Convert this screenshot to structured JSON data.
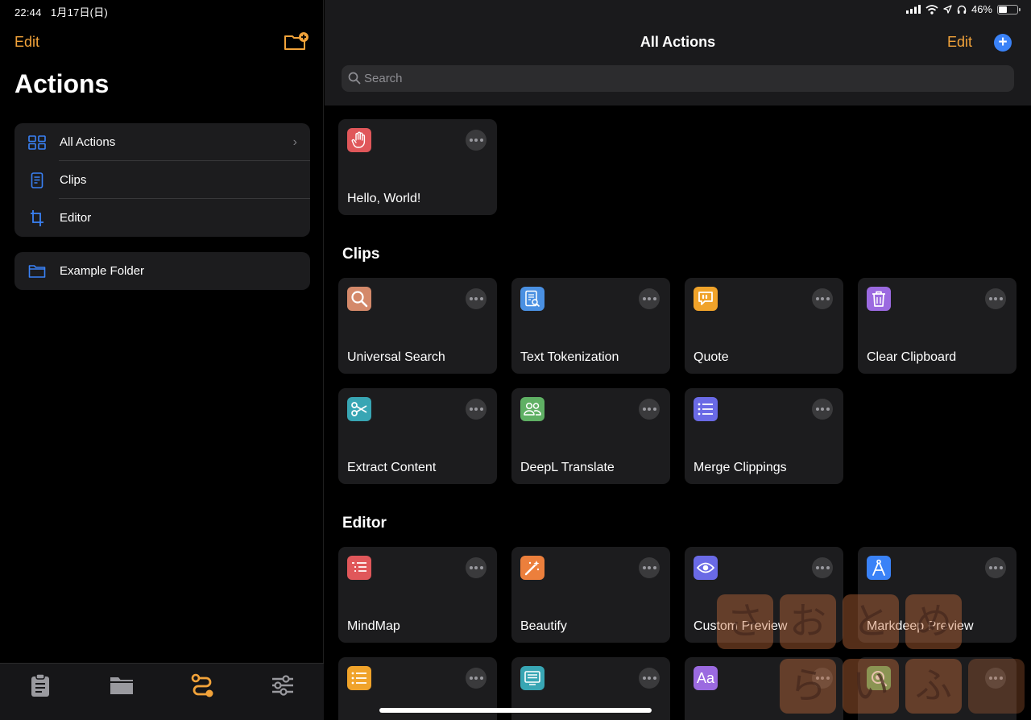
{
  "status_bar": {
    "time": "22:44",
    "date": "1月17日(日)",
    "battery": "46%",
    "battery_level": 0.46
  },
  "sidebar": {
    "edit_label": "Edit",
    "title": "Actions",
    "items": [
      {
        "label": "All Actions",
        "icon": "grid-icon"
      },
      {
        "label": "Clips",
        "icon": "document-icon"
      },
      {
        "label": "Editor",
        "icon": "crop-icon"
      }
    ],
    "folders": [
      {
        "label": "Example Folder",
        "icon": "folder-icon"
      }
    ]
  },
  "tabbar": {
    "tabs": [
      {
        "icon": "clipboard-icon",
        "active": false
      },
      {
        "icon": "folder-icon",
        "active": false
      },
      {
        "icon": "route-icon",
        "active": true
      },
      {
        "icon": "sliders-icon",
        "active": false
      }
    ]
  },
  "main": {
    "title": "All Actions",
    "edit_label": "Edit",
    "search_placeholder": "Search",
    "ungrouped": [
      {
        "name": "Hello, World!",
        "icon": "hand-icon",
        "color": "#e0575a"
      }
    ],
    "sections": [
      {
        "title": "Clips",
        "actions": [
          {
            "name": "Universal Search",
            "icon": "magnifier-icon",
            "color": "#d4896a"
          },
          {
            "name": "Text Tokenization",
            "icon": "doc-search-icon",
            "color": "#4a90e2"
          },
          {
            "name": "Quote",
            "icon": "quote-bubble-icon",
            "color": "#f0a32a"
          },
          {
            "name": "Clear Clipboard",
            "icon": "trash-icon",
            "color": "#9b6ae0"
          },
          {
            "name": "Extract Content",
            "icon": "scissors-icon",
            "color": "#38a6b4"
          },
          {
            "name": "DeepL Translate",
            "icon": "people-icon",
            "color": "#5fb064"
          },
          {
            "name": "Merge Clippings",
            "icon": "list-icon",
            "color": "#6a6ae6"
          }
        ]
      },
      {
        "title": "Editor",
        "actions": [
          {
            "name": "MindMap",
            "icon": "list-icon",
            "color": "#e0575a"
          },
          {
            "name": "Beautify",
            "icon": "magic-wand-icon",
            "color": "#ec7f3c"
          },
          {
            "name": "Custom Preview",
            "icon": "eye-icon",
            "color": "#6a6ae6"
          },
          {
            "name": "Markdeep Preview",
            "icon": "compass-icon",
            "color": "#3a82f7"
          },
          {
            "name": "",
            "icon": "list-icon",
            "color": "#f0a32a"
          },
          {
            "name": "",
            "icon": "monitor-icon",
            "color": "#38a6b4"
          },
          {
            "name": "",
            "icon": "font-icon",
            "color": "#9b6ae0",
            "glyph": "Aa"
          },
          {
            "name": "",
            "icon": "search-q-icon",
            "color": "#5fb064"
          }
        ]
      }
    ]
  },
  "watermark": {
    "chars": [
      "さ",
      "お",
      "と",
      "め",
      "ら",
      "い",
      "ふ"
    ]
  }
}
